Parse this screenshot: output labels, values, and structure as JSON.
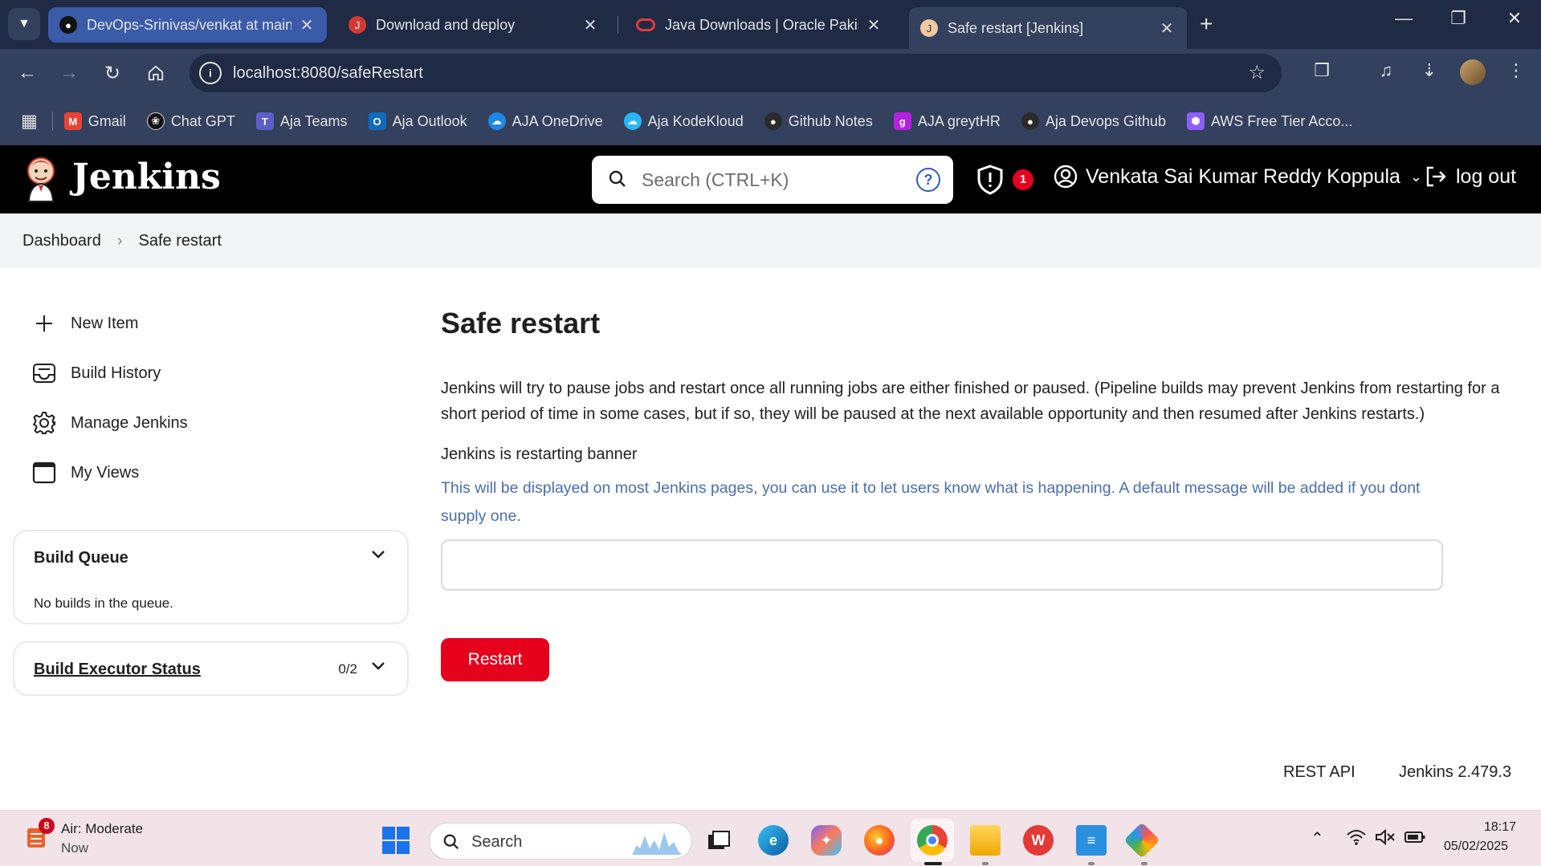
{
  "browser": {
    "tabs": [
      {
        "title": "DevOps-Srinivas/venkat at main",
        "icon": "github-icon",
        "active": false
      },
      {
        "title": "Download and deploy",
        "icon": "jenkins-icon",
        "active": false
      },
      {
        "title": "Java Downloads | Oracle Pakistan",
        "icon": "oracle-icon",
        "active": false
      },
      {
        "title": "Safe restart [Jenkins]",
        "icon": "jenkins-icon",
        "active": true
      }
    ],
    "url": "localhost:8080/safeRestart",
    "bookmarks": [
      {
        "label": "Gmail",
        "icon": "gmail-icon",
        "color": "#ea4335"
      },
      {
        "label": "Chat GPT",
        "icon": "chatgpt-icon",
        "color": "#111111"
      },
      {
        "label": "Aja Teams",
        "icon": "teams-icon",
        "color": "#5b5fc7"
      },
      {
        "label": "Aja Outlook",
        "icon": "outlook-icon",
        "color": "#0f6cbd"
      },
      {
        "label": "AJA OneDrive",
        "icon": "onedrive-icon",
        "color": "#1e88e5"
      },
      {
        "label": "Aja KodeKloud",
        "icon": "kodekloud-icon",
        "color": "#29b6f6"
      },
      {
        "label": "Github Notes",
        "icon": "github-icon",
        "color": "#2b2b2b"
      },
      {
        "label": "AJA greytHR",
        "icon": "greythr-icon",
        "color": "#b620e0"
      },
      {
        "label": "Aja Devops Github",
        "icon": "github-icon",
        "color": "#2b2b2b"
      },
      {
        "label": "AWS Free Tier Acco...",
        "icon": "aws-icon",
        "color": "#8e5cff"
      }
    ]
  },
  "jenkins": {
    "brand": "Jenkins",
    "search_placeholder": "Search (CTRL+K)",
    "security_badge": "1",
    "user_name": "Venkata Sai Kumar Reddy Koppula",
    "logout_label": "log out",
    "breadcrumb": {
      "root": "Dashboard",
      "current": "Safe restart"
    },
    "tasks": [
      {
        "label": "New Item",
        "icon": "plus-icon"
      },
      {
        "label": "Build History",
        "icon": "inbox-icon"
      },
      {
        "label": "Manage Jenkins",
        "icon": "gear-icon"
      },
      {
        "label": "My Views",
        "icon": "window-icon"
      }
    ],
    "build_queue": {
      "title": "Build Queue",
      "empty_text": "No builds in the queue."
    },
    "executor_status": {
      "title": "Build Executor Status",
      "count": "0/2"
    },
    "main": {
      "title": "Safe restart",
      "description": "Jenkins will try to pause jobs and restart once all running jobs are either finished or paused. (Pipeline builds may prevent Jenkins from restarting for a short period of time in some cases, but if so, they will be paused at the next available opportunity and then resumed after Jenkins restarts.)",
      "field_label": "Jenkins is restarting banner",
      "field_help": "This will be displayed on most Jenkins pages, you can use it to let users know what is happening. A default message will be added if you dont supply one.",
      "field_value": "",
      "button_label": "Restart"
    },
    "footer": {
      "rest_api": "REST API",
      "version": "Jenkins 2.479.3"
    }
  },
  "taskbar": {
    "weather_badge": "8",
    "weather_title": "Air: Moderate",
    "weather_sub": "Now",
    "search_label": "Search",
    "time": "18:17",
    "date": "05/02/2025"
  }
}
